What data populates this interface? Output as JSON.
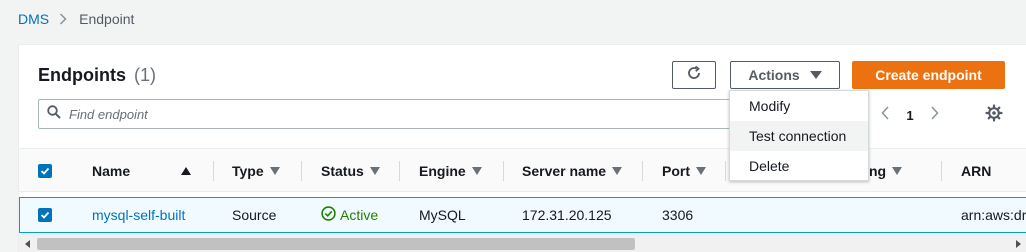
{
  "breadcrumb": {
    "root": "DMS",
    "current": "Endpoint"
  },
  "header": {
    "title": "Endpoints",
    "count": "(1)"
  },
  "toolbar": {
    "actions_label": "Actions",
    "create_label": "Create endpoint"
  },
  "search": {
    "placeholder": "Find endpoint"
  },
  "pagination": {
    "current_page": "1"
  },
  "table": {
    "columns": [
      "Name",
      "Type",
      "Status",
      "Engine",
      "Server name",
      "Port",
      "Mapping",
      "ARN"
    ],
    "visible_column_text": {
      "mapping_partial": "pping"
    },
    "rows": [
      {
        "selected": true,
        "name": "mysql-self-built",
        "type": "Source",
        "status": "Active",
        "engine": "MySQL",
        "server_name": "172.31.20.125",
        "port": "3306",
        "arn": "arn:aws:dr"
      }
    ]
  },
  "actions_menu": {
    "items": [
      "Modify",
      "Test connection",
      "Delete"
    ],
    "hovered": "Test connection"
  },
  "colors": {
    "link": "#0073bb",
    "primary": "#ec7211",
    "success": "#1d8102",
    "selected_row": "#f1faff",
    "selected_border": "#00a1c9"
  },
  "icons": [
    "chevron-right-icon",
    "refresh-icon",
    "caret-down-icon",
    "search-icon",
    "chevron-left-icon",
    "gear-icon",
    "sort-up-icon",
    "sort-down-icon",
    "check-circle-icon",
    "checkbox-checked-icon"
  ]
}
